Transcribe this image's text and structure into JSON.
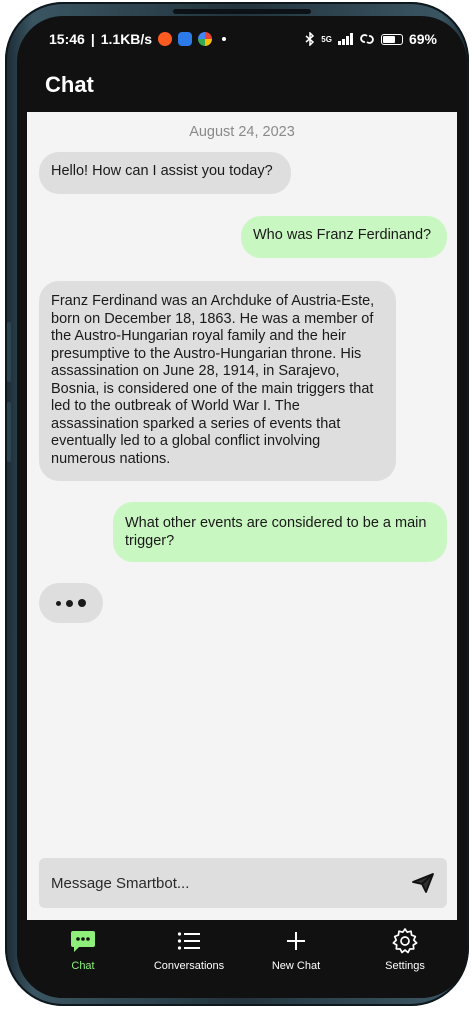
{
  "status_bar": {
    "time": "15:46",
    "speed": "1.1KB/s",
    "network": "5G",
    "battery": "69%"
  },
  "header": {
    "title": "Chat"
  },
  "chat": {
    "date": "August 24, 2023",
    "messages": [
      {
        "role": "bot",
        "text": "Hello! How can I assist you today?"
      },
      {
        "role": "user",
        "text": "Who was Franz Ferdinand?"
      },
      {
        "role": "bot",
        "text": "Franz Ferdinand was an Archduke of Austria-Este, born on December 18, 1863. He was a member of the Austro-Hungarian royal family and the heir presumptive to the Austro-Hungarian throne. His assassination on June 28, 1914, in Sarajevo, Bosnia, is considered one of the main triggers that led to the outbreak of World War I. The assassination sparked a series of events that eventually led to a global conflict involving numerous nations."
      },
      {
        "role": "user",
        "text": "What other events are considered to be a main trigger?"
      }
    ]
  },
  "composer": {
    "placeholder": "Message Smartbot..."
  },
  "nav": {
    "chat": "Chat",
    "conversations": "Conversations",
    "new_chat": "New Chat",
    "settings": "Settings"
  },
  "colors": {
    "user_bubble": "#c9f7c1",
    "bot_bubble": "#dedede",
    "accent": "#8ef07a",
    "background": "#f4f4f4"
  }
}
